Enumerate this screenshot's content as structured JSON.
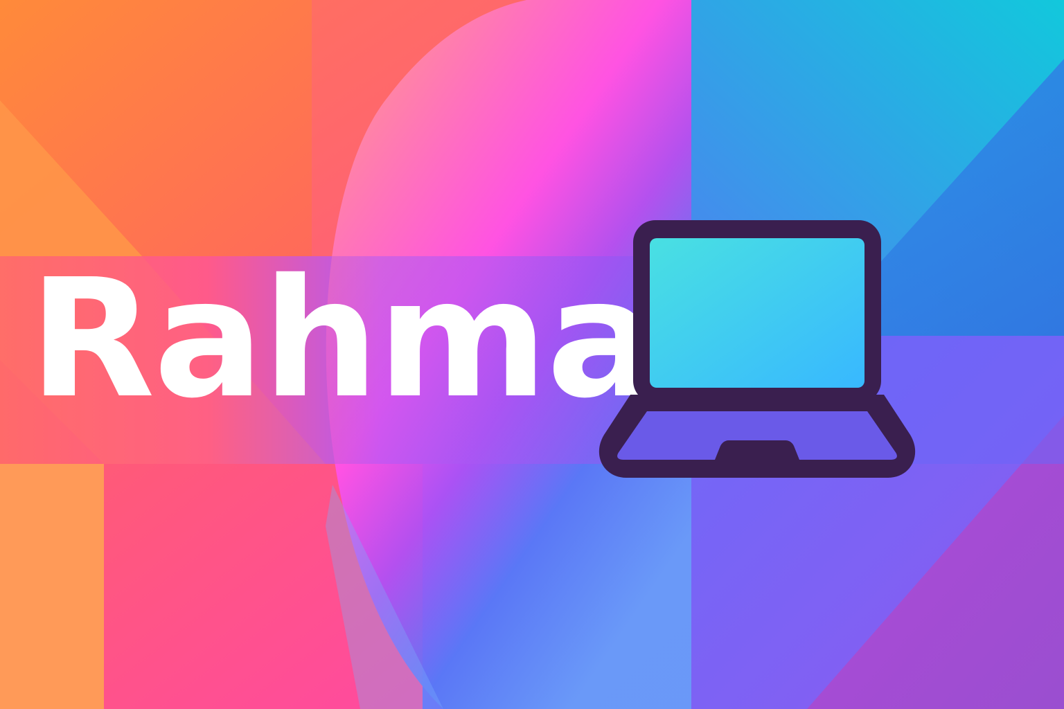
{
  "brand": {
    "name": "Rahma"
  },
  "icon": {
    "name": "laptop-icon"
  },
  "colors": {
    "text": "#ffffff",
    "icon_outline": "#3a1f4f",
    "icon_screen_start": "#49e0e2",
    "icon_screen_end": "#38b8ff",
    "icon_base": "#6a5ae8",
    "background_warm": "#ff7a3c",
    "background_pink": "#ff46c8",
    "background_cool": "#18c6de",
    "background_violet": "#6b5cf5"
  }
}
